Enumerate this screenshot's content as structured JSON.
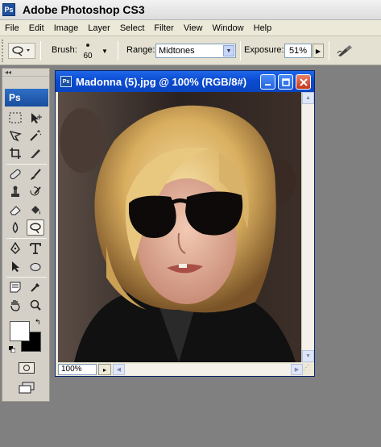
{
  "app": {
    "logo_text": "Ps",
    "title": "Adobe Photoshop CS3"
  },
  "menu": [
    "File",
    "Edit",
    "Image",
    "Layer",
    "Select",
    "Filter",
    "View",
    "Window",
    "Help"
  ],
  "options": {
    "brush_label": "Brush:",
    "brush_size": "60",
    "range_label": "Range:",
    "range_value": "Midtones",
    "exposure_label": "Exposure:",
    "exposure_value": "51%"
  },
  "toolbox": {
    "collapse_glyph": "◂◂",
    "logo_text": "Ps",
    "active_tool": "dodge"
  },
  "document": {
    "icon_text": "Ps",
    "title": "Madonna (5).jpg @ 100% (RGB/8#)",
    "zoom": "100%"
  },
  "colors": {
    "foreground": "#ffffff",
    "background": "#000000",
    "xp_title": "#0b4bd1",
    "canvas_bg": "#808080"
  }
}
